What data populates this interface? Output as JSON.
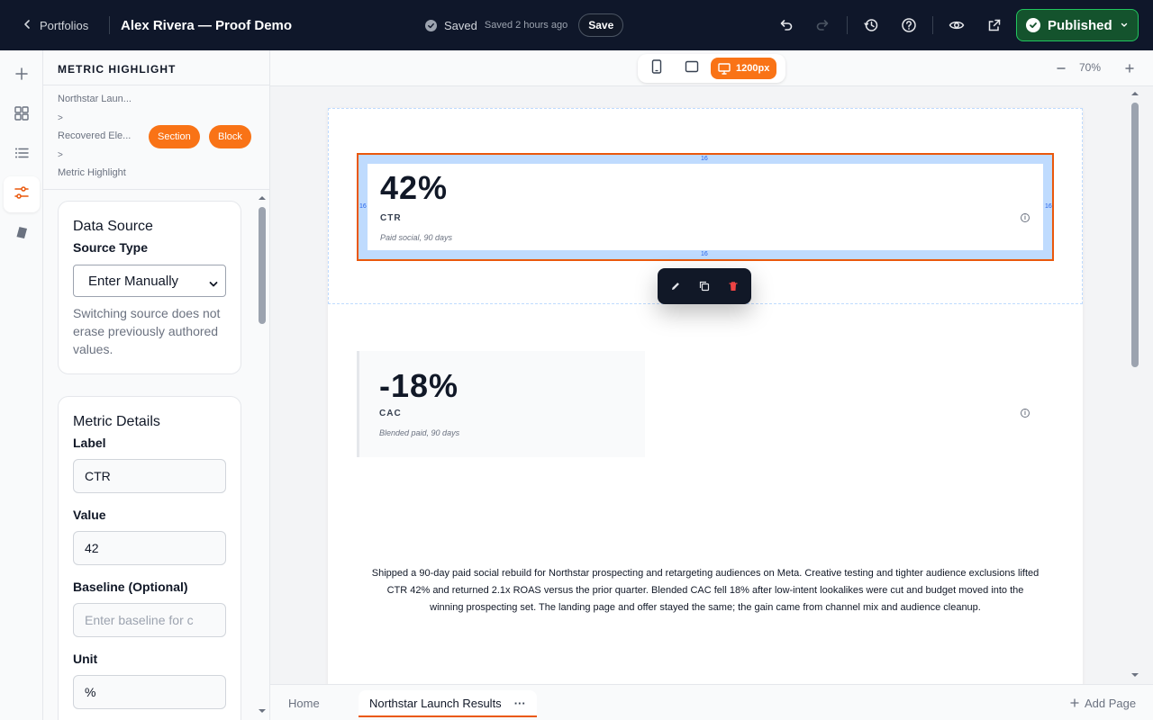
{
  "topbar": {
    "back_label": "Portfolios",
    "title": "Alex Rivera — Proof Demo",
    "saved_status": "Saved",
    "saved_time": "Saved 2 hours ago",
    "save_label": "Save",
    "publish_label": "Published",
    "publish_color": "#14532d"
  },
  "rail": {
    "items": [
      "plus-icon",
      "grid-icon",
      "list-icon",
      "sliders-icon",
      "paint-icon"
    ],
    "active": "sliders-icon"
  },
  "panel": {
    "title": "METRIC HIGHLIGHT",
    "breadcrumb": {
      "item1": "Northstar Laun...",
      "sep": ">",
      "item2": "Recovered Ele...",
      "item3": "Metric Highlight",
      "pill_section": "Section",
      "pill_block": "Block"
    },
    "data_source": {
      "title": "Data Source",
      "source_type_label": "Source Type",
      "source_type_value": "Enter Manually",
      "help": "Switching source does not erase previously authored values."
    },
    "metric_details": {
      "title": "Metric Details",
      "label_label": "Label",
      "label_value": "CTR",
      "value_label": "Value",
      "value_value": "42",
      "baseline_label": "Baseline (Optional)",
      "baseline_placeholder": "Enter baseline for c",
      "unit_label": "Unit",
      "unit_value": "%"
    }
  },
  "canvas_bar": {
    "device_active_label": "1200px",
    "zoom": "70%",
    "accent": "#f97316"
  },
  "canvas": {
    "padding_value": "16",
    "metric1": {
      "value": "42%",
      "label": "CTR",
      "sub": "Paid social, 90 days"
    },
    "metric2": {
      "value": "-18%",
      "label": "CAC",
      "sub": "Blended paid, 90 days"
    },
    "paragraph": "Shipped a 90-day paid social rebuild for Northstar prospecting and retargeting audiences on Meta. Creative testing and tighter audience exclusions lifted CTR 42% and returned 2.1x ROAS versus the prior quarter. Blended CAC fell 18% after low-intent lookalikes were cut and budget moved into the winning prospecting set. The landing page and offer stayed the same; the gain came from channel mix and audience cleanup."
  },
  "page_tabs": {
    "tabs": [
      "Home",
      "Northstar Launch Results"
    ],
    "active": "Northstar Launch Results",
    "more": "···",
    "add_page": "Add Page"
  }
}
